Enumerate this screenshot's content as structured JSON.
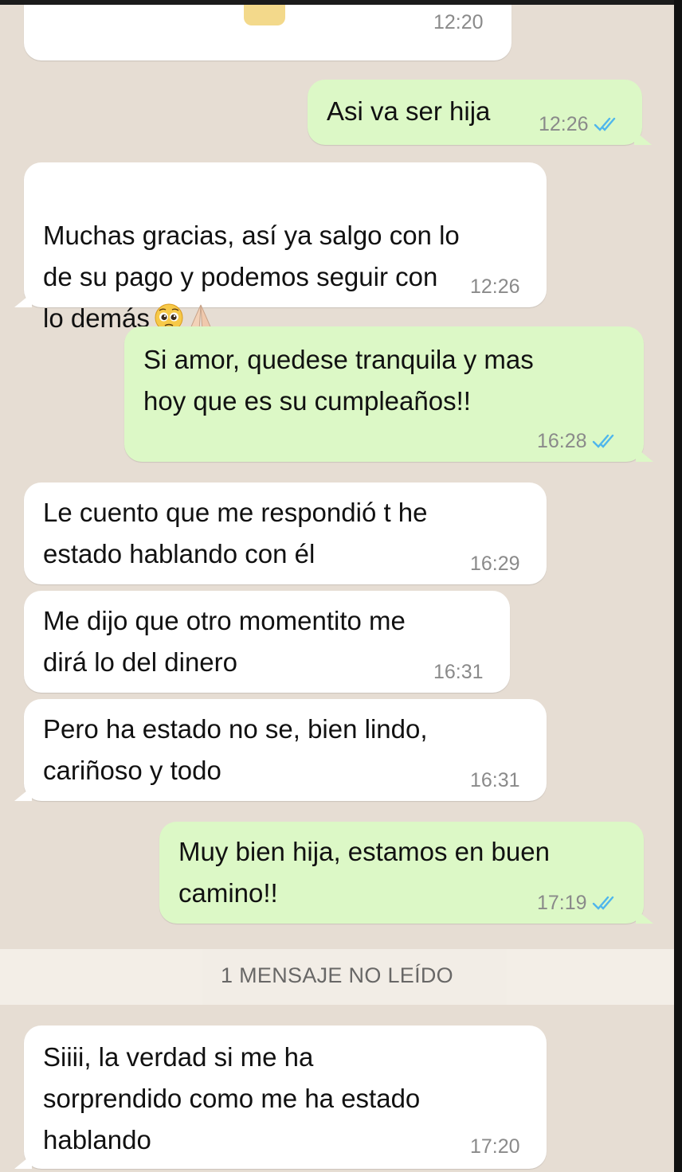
{
  "messages": [
    {
      "dir": "in",
      "text": "",
      "time": "12:20"
    },
    {
      "dir": "out",
      "text": "Asi va ser hija",
      "time": "12:26"
    },
    {
      "dir": "in",
      "text": "Muchas gracias, así ya salgo con lo\nde su pago y podemos seguir con\nlo demás",
      "time": "12:26",
      "emojis": [
        "pleading-face-emoji",
        "folded-hands-emoji"
      ]
    },
    {
      "dir": "out",
      "text": "Si amor, quedese tranquila y mas\nhoy que es su cumpleaños!!",
      "time": "16:28"
    },
    {
      "dir": "in",
      "text": "Le cuento que me respondió t he\nestado hablando con él",
      "time": "16:29"
    },
    {
      "dir": "in",
      "text": "Me dijo que otro momentito me\ndirá lo del dinero",
      "time": "16:31"
    },
    {
      "dir": "in",
      "text": "Pero ha estado no se, bien lindo,\ncariñoso y todo",
      "time": "16:31"
    },
    {
      "dir": "out",
      "text": "Muy bien hija, estamos en buen\ncamino!!",
      "time": "17:19"
    },
    {
      "dir": "in",
      "text": "Siiii, la verdad si me ha\nsorprendido como me ha estado\nhablando",
      "time": "17:20"
    }
  ],
  "unread_divider": "1 MENSAJE NO LEÍDO",
  "colors": {
    "background": "#e6ddd3",
    "incoming_bubble": "#ffffff",
    "outgoing_bubble": "#dcf8c6",
    "read_ticks": "#4fb6ec",
    "timestamp": "#8a8a8a"
  },
  "icons": [
    "read-receipt-icon"
  ]
}
